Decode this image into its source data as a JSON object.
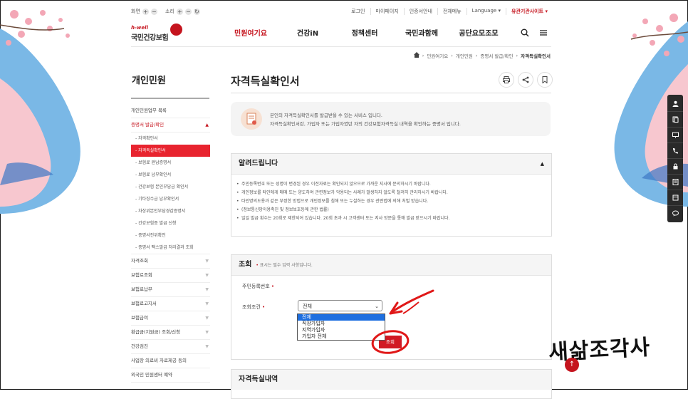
{
  "util": {
    "font_size_label": "화면",
    "sound_label": "소리",
    "links": [
      "로그인",
      "마이페이지",
      "인증서안내",
      "전체메뉴",
      "Language ▾"
    ],
    "affiliate": "유관기관사이트 ▾"
  },
  "logo": {
    "sub": "h-well",
    "main": "국민건강보험"
  },
  "gnb": [
    "민원여기요",
    "건강iN",
    "정책센터",
    "국민과함께",
    "공단요모조모"
  ],
  "breadcrumb": [
    "민원여기요",
    "개인민원",
    "증명서 발급/확인",
    "자격득실확인서"
  ],
  "lnb": {
    "title": "개인민원",
    "top_items": [
      "개인민원업무 목록",
      "증명서 발급/확인"
    ],
    "sub_items": [
      "자격확인서",
      "자격득실확인서",
      "보험료 완납증명서",
      "보험료 납부확인서",
      "건강보험 본인부담금 확인서",
      "기타징수금 납부확인서",
      "차상위본인부담경감증명서",
      "건강보험증 발급 신청",
      "증명서진위확인",
      "증명서 팩스발급 처리결과 조회"
    ],
    "more_items": [
      "자격조회",
      "보험료조회",
      "보험료납부",
      "보험료고지서",
      "보험급여",
      "환급금(지원금) 조회/신청",
      "건강검진",
      "사업장 의료비 자료제공 동의",
      "외국인 민원센터 예약"
    ]
  },
  "page": {
    "title": "자격득실확인서",
    "info_lines": [
      "본인의 자격득실확인서를 발급받을 수 있는 서비스 입니다.",
      "자격득실확인서란, 가입자 또는 가입자였던 자의 건강보험자격득실 내역을 확인하는 증명서 입니다."
    ]
  },
  "notice": {
    "heading": "알려드립니다",
    "items": [
      "주민등록번호 또는 성명이 변경된 경우 이전자료는 확인되지 않으므로 가까운 지사에 문의하시기 바랍니다.",
      "개인정보를 타인에게 매매 또는 양도하여 관련정보가 악용되는 사례가 발생하지 않도록 철저히 관리하시기 바랍니다.",
      "타인명의도용과 같은 부정한 방법으로 개인정보를 침해 또는 누설하는 경우 관련법에 의해 처벌 받습니다.",
      "(정보통신망이용촉진 및 정보보호등에 관한 법률)",
      "일일 발급 횟수는 20회로 제한되어 있습니다. 20회 초과 시 고객센터 또는 지사 방문을 통해 발급 받으시기 바랍니다."
    ]
  },
  "search": {
    "heading": "조회",
    "required_note": "표시는 필수 입력 사항입니다.",
    "resident_label": "주민등록번호",
    "condition_label": "조회조건",
    "selected": "전체",
    "options": [
      "전체",
      "직장가입자",
      "지역가입자",
      "가입자 전체"
    ],
    "button": "조회"
  },
  "result": {
    "heading": "자격득실내역"
  },
  "watermark": "새삶조각사",
  "colors": {
    "brand": "#c5141e",
    "select_highlight": "#1e6fe0"
  }
}
